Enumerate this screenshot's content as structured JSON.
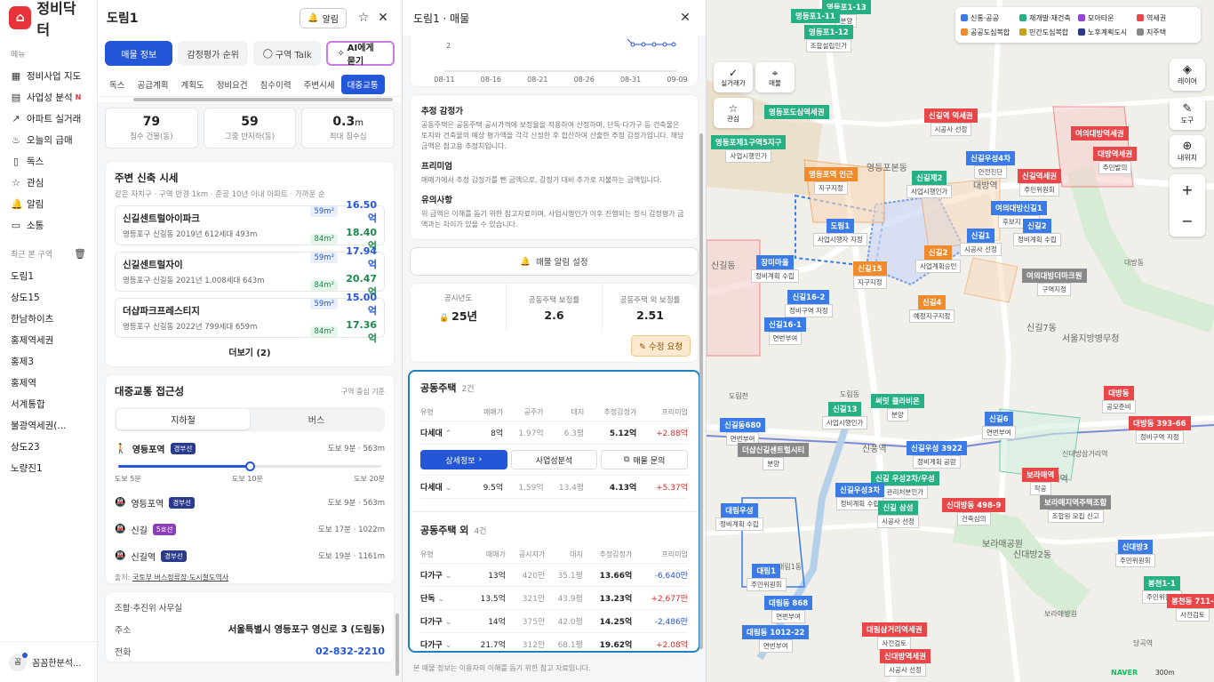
{
  "app": {
    "logo": "정비닥터"
  },
  "nav": {
    "section": "메뉴",
    "items": [
      {
        "label": "정비사업 지도",
        "icon": "map-icon"
      },
      {
        "label": "사업성 분석",
        "icon": "book-icon",
        "badge": "N"
      },
      {
        "label": "아파트 실거래",
        "icon": "trend-icon"
      },
      {
        "label": "오늘의 급매",
        "icon": "fire-icon"
      },
      {
        "label": "독스",
        "icon": "doc-icon"
      },
      {
        "label": "관심",
        "icon": "star-icon"
      },
      {
        "label": "알림",
        "icon": "bell-icon"
      },
      {
        "label": "소통",
        "icon": "chat-icon"
      }
    ],
    "recent_title": "최근 본 구역",
    "recent": [
      "도림1",
      "상도15",
      "한남하이츠",
      "홍제역세권",
      "홍제3",
      "홍제역",
      "서계통합",
      "불광역세권(...",
      "상도23",
      "노량진1"
    ],
    "profile": {
      "avatar": "꼼",
      "name": "꼼꼼한분석..."
    }
  },
  "panel1": {
    "title": "도림1",
    "alarm_label": "알림",
    "tabs": [
      "매물 정보",
      "감정평가 순위",
      "구역 Talk",
      "AI에게 묻기"
    ],
    "subtabs": [
      "독스",
      "공급계획",
      "계획도",
      "정비요건",
      "침수이력",
      "주변시세",
      "대중교통"
    ],
    "stats": [
      {
        "value": "79",
        "unit": "",
        "label": "침수 건물(동)"
      },
      {
        "value": "59",
        "unit": "",
        "label": "그중 반지하(동)"
      },
      {
        "value": "0.3",
        "unit": "m",
        "label": "최대 침수심"
      }
    ],
    "nearby": {
      "title": "주변 신축 시세",
      "subtitle": "같은 자치구 · 구역 반경 1km · 준공 10년 이내 아파트 · 가까운 순",
      "items": [
        {
          "name": "신길센트럴아이파크",
          "meta": "영등포구 신길동   2019년   612세대   493m",
          "p1_area": "59m²",
          "p1": "16.50억",
          "p2_area": "84m²",
          "p2": "18.40억"
        },
        {
          "name": "신길센트럴자이",
          "meta": "영등포구 신길동   2021년   1,008세대   643m",
          "p1_area": "59m²",
          "p1": "17.94억",
          "p2_area": "84m²",
          "p2": "20.47억"
        },
        {
          "name": "더샵파크프레스티지",
          "meta": "영등포구 신길동   2022년   799세대   659m",
          "p1_area": "59m²",
          "p1": "15.00억",
          "p2_area": "84m²",
          "p2": "17.36억"
        }
      ],
      "more": "더보기 (2)"
    },
    "transit": {
      "title": "대중교통 접근성",
      "criteria": "구역 중심 기준",
      "seg": [
        "지하철",
        "버스"
      ],
      "primary": {
        "name": "영등포역",
        "line": "경부선",
        "line_color": "#2a3a8c",
        "dist": "도보 9분 · 563m"
      },
      "slider_labels": [
        "도보 5분",
        "도보 10분",
        "도보 20분"
      ],
      "slider_value": 0.5,
      "stations": [
        {
          "name": "영등포역",
          "line": "경부선",
          "line_color": "#2a3a8c",
          "dist": "도보 9분 · 563m"
        },
        {
          "name": "신길",
          "line": "5호선",
          "line_color": "#8a3fb8",
          "dist": "도보 17분 · 1022m"
        },
        {
          "name": "신길역",
          "line": "경부선",
          "line_color": "#2a3a8c",
          "dist": "도보 19분 · 1161m"
        }
      ],
      "source_prefix": "출처: ",
      "source": "국토부 버스정류장·도시철도역사"
    },
    "office": {
      "title": "조합·추진위 사무실",
      "addr_label": "주소",
      "addr": "서울특별시 영등포구 영신로 3 (도림동)",
      "tel_label": "전화",
      "tel": "02-832-2210"
    }
  },
  "panel2": {
    "title": "도림1 · 매물",
    "chart_data": {
      "type": "line",
      "x": [
        "08-11",
        "08-16",
        "08-21",
        "08-26",
        "08-31",
        "09-09"
      ],
      "ytick": "2",
      "values": [
        2,
        2,
        2,
        2,
        2
      ]
    },
    "info": [
      {
        "h": "추정 감정가",
        "p": "공동주택은 공동주택 공시가격에 보정율을 적용하여 산정하며, 단독·다가구 등 건축물은 토지와 건축물의 예상 평가액을 각각 산정한 후 합산하여 산출한 추정 감정가입니다. 해당 금액은 참고용 추정치입니다."
      },
      {
        "h": "프리미엄",
        "p": "매매가에서 추정 감정가를 뺀 금액으로, 감정가 대비 추가로 지불하는 금액입니다."
      },
      {
        "h": "유의사항",
        "p": "위 금액은 이해를 돕기 위한 참고자료이며, 사업시행인가 이후 진행되는 정식 감정평가 금액과는 차이가 있을 수 있습니다."
      }
    ],
    "alert_btn": "매물 알림 설정",
    "tri": [
      {
        "label": "공시년도",
        "value": "25년"
      },
      {
        "label": "공동주택 보정률",
        "value": "2.6"
      },
      {
        "label": "공동주택 외 보정률",
        "value": "2.51"
      }
    ],
    "fix_btn": "수정 요청",
    "apt": {
      "title": "공동주택",
      "count": "2건",
      "cols": [
        "유형",
        "매매가",
        "공주가",
        "대지",
        "추정감정가",
        "프리미엄"
      ],
      "rows": [
        {
          "type": "다세대",
          "chev": "up",
          "price": "8억",
          "gp": "1.97억",
          "land": "6.3평",
          "est": "5.12억",
          "prem": "+2.88억",
          "sign": "pos"
        },
        {
          "type": "다세대",
          "chev": "down",
          "price": "9.5억",
          "gp": "1.59억",
          "land": "13.4평",
          "est": "4.13억",
          "prem": "+5.37억",
          "sign": "pos"
        }
      ],
      "actions": [
        "상세정보",
        "사업성분석",
        "매물 문의"
      ]
    },
    "other": {
      "title": "공동주택 외",
      "count": "4건",
      "cols": [
        "유형",
        "매매가",
        "공시지가",
        "대지",
        "추정감정가",
        "프리미엄"
      ],
      "rows": [
        {
          "type": "다가구",
          "price": "13억",
          "gp": "420만",
          "land": "35.1평",
          "est": "13.66억",
          "prem": "-6,640만",
          "sign": "neg"
        },
        {
          "type": "단독",
          "price": "13.5억",
          "gp": "321만",
          "land": "43.9평",
          "est": "13.23억",
          "prem": "+2,677만",
          "sign": "pos"
        },
        {
          "type": "다가구",
          "price": "14억",
          "gp": "375만",
          "land": "42.0평",
          "est": "14.25억",
          "prem": "-2,486만",
          "sign": "neg"
        },
        {
          "type": "다가구",
          "price": "21.7억",
          "gp": "312만",
          "land": "68.1평",
          "est": "19.62억",
          "prem": "+2.08억",
          "sign": "pos"
        }
      ]
    },
    "footer": "본 매물 정보는 이용자의 이해를 돕기 위한 참고 자료입니다."
  },
  "map": {
    "legend": [
      {
        "label": "신통·공공",
        "color": "#3a7be8"
      },
      {
        "label": "재개발·재건축",
        "color": "#27b083"
      },
      {
        "label": "모아타운",
        "color": "#9146d8"
      },
      {
        "label": "역세권",
        "color": "#e8474a"
      },
      {
        "label": "공공도심복합",
        "color": "#f08a2a"
      },
      {
        "label": "민간도심복합",
        "color": "#c9a01a"
      },
      {
        "label": "노후계획도시",
        "color": "#2a3a8c"
      },
      {
        "label": "지주택",
        "color": "#888888"
      }
    ],
    "left_tools": [
      {
        "label": "실거래가",
        "icon": "check-circle-icon"
      },
      {
        "label": "매물",
        "icon": "pin-icon"
      },
      {
        "label": "관심",
        "icon": "star-icon"
      }
    ],
    "right_tools": [
      {
        "label": "레이어",
        "icon": "layers-icon"
      },
      {
        "label": "도구",
        "icon": "wrench-icon"
      },
      {
        "label": "내위치",
        "icon": "crosshair-icon"
      }
    ],
    "zoom": [
      "+",
      "−"
    ],
    "zones": [
      {
        "t": "영등포1-13",
        "s": "분양",
        "c": "#27b083"
      },
      {
        "t": "영등포1-11",
        "s": "",
        "c": "#27b083"
      },
      {
        "t": "영등포1-12",
        "s": "조합설립인가",
        "c": "#27b083"
      },
      {
        "t": "영등포도심역세권",
        "s": "",
        "c": "#27b083"
      },
      {
        "t": "영등포제1구역5지구",
        "s": "사업시행인가",
        "c": "#27b083"
      },
      {
        "t": "신길역 역세권",
        "s": "시공사 선정",
        "c": "#e8474a"
      },
      {
        "t": "여의대방역세권",
        "s": "",
        "c": "#e8474a"
      },
      {
        "t": "대방역세권",
        "s": "주민발의",
        "c": "#e8474a"
      },
      {
        "t": "신길우성4차",
        "s": "안전진단",
        "c": "#3a7be8"
      },
      {
        "t": "영등포역 인근",
        "s": "지구지정",
        "c": "#f08a2a"
      },
      {
        "t": "신길제2",
        "s": "사업시행인가",
        "c": "#27b083"
      },
      {
        "t": "신길역세권",
        "s": "주민위원회",
        "c": "#e8474a"
      },
      {
        "t": "도림1",
        "s": "사업시행자 지정",
        "c": "#3a7be8"
      },
      {
        "t": "여의대방신길1",
        "s": "후보지 선정",
        "c": "#3a7be8"
      },
      {
        "t": "신길1",
        "s": "시공사 선정",
        "c": "#3a7be8"
      },
      {
        "t": "신길2",
        "s": "정비계획 수립",
        "c": "#3a7be8"
      },
      {
        "t": "장미마을",
        "s": "정비계획 수립",
        "c": "#3a7be8"
      },
      {
        "t": "신길15",
        "s": "지구지정",
        "c": "#f08a2a"
      },
      {
        "t": "신길2",
        "s": "사업계획승인",
        "c": "#f08a2a"
      },
      {
        "t": "여의대방더마크원",
        "s": "구역지정",
        "c": "#888888"
      },
      {
        "t": "신길16-2",
        "s": "정비구역 지정",
        "c": "#3a7be8"
      },
      {
        "t": "신길4",
        "s": "예정지구지정",
        "c": "#f08a2a"
      },
      {
        "t": "신길16-1",
        "s": "연번부여",
        "c": "#3a7be8"
      },
      {
        "t": "신길13",
        "s": "사업시행인가",
        "c": "#27b083"
      },
      {
        "t": "써밋 클라비온",
        "s": "분양",
        "c": "#27b083"
      },
      {
        "t": "대방동",
        "s": "공모준비",
        "c": "#e8474a"
      },
      {
        "t": "대방동 393-66",
        "s": "정비구역 지정",
        "c": "#e8474a"
      },
      {
        "t": "신길6",
        "s": "연번부여",
        "c": "#3a7be8"
      },
      {
        "t": "신길동680",
        "s": "연번부여",
        "c": "#3a7be8"
      },
      {
        "t": "더샵신길센트럴시티",
        "s": "분양",
        "c": "#888888"
      },
      {
        "t": "신길우성 3922",
        "s": "정비계획 공람",
        "c": "#3a7be8"
      },
      {
        "t": "보라매역",
        "s": "착공",
        "c": "#e8474a"
      },
      {
        "t": "신길 우성2차/우성",
        "s": "관리처분인가",
        "c": "#27b083"
      },
      {
        "t": "신길우성3차",
        "s": "정비계획 수립",
        "c": "#3a7be8"
      },
      {
        "t": "신길 삼성",
        "s": "시공사 선정",
        "c": "#27b083"
      },
      {
        "t": "신대방동 498-9",
        "s": "건축심의",
        "c": "#e8474a"
      },
      {
        "t": "보라매지역주택조합",
        "s": "조합원 모집 신고",
        "c": "#888888"
      },
      {
        "t": "대림우성",
        "s": "정비계획 수립",
        "c": "#3a7be8"
      },
      {
        "t": "신대방3",
        "s": "주민위원회",
        "c": "#3a7be8"
      },
      {
        "t": "대림1",
        "s": "주민위원회",
        "c": "#3a7be8"
      },
      {
        "t": "봉천1-1",
        "s": "주민위원회",
        "c": "#27b083"
      },
      {
        "t": "대림동 868",
        "s": "연번부여",
        "c": "#3a7be8"
      },
      {
        "t": "봉천동 711-",
        "s": "사전검토",
        "c": "#e8474a"
      },
      {
        "t": "대림동 1012-22",
        "s": "연번부여",
        "c": "#3a7be8"
      },
      {
        "t": "대림삼거리역세권",
        "s": "사전검토",
        "c": "#e8474a"
      },
      {
        "t": "신대방역세권",
        "s": "시공사 선정",
        "c": "#e8474a"
      }
    ],
    "places": [
      "신길동",
      "영등포본동",
      "신길7동",
      "서울지방병무청",
      "신풍역",
      "보라매공원",
      "신대방2동",
      "대방역",
      "보라매역",
      "대림1동",
      "보라매병원",
      "신대방삼거리역",
      "당곡역",
      "도림동",
      "대방동",
      "도림천"
    ],
    "brand": "NAVER",
    "scale": "300m"
  }
}
